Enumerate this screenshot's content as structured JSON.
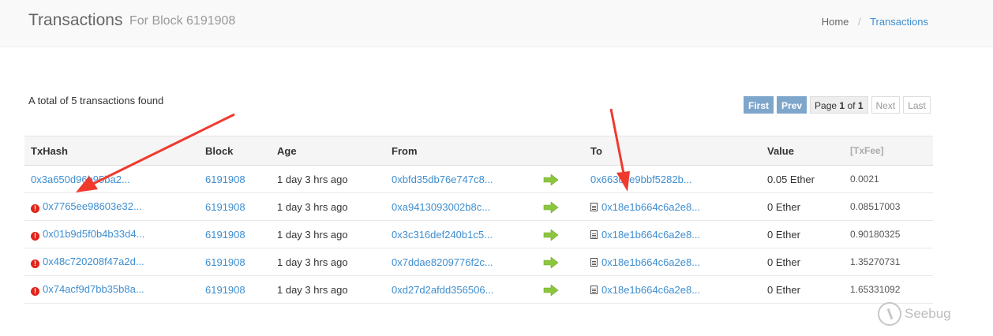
{
  "header": {
    "title": "Transactions",
    "subtitle": "For Block 6191908",
    "breadcrumb": {
      "home": "Home",
      "separator": "/",
      "current": "Transactions"
    }
  },
  "summary": {
    "total_text": "A total of 5 transactions found"
  },
  "pager": {
    "first": "First",
    "prev": "Prev",
    "page_prefix": "Page",
    "page_current": "1",
    "page_of": "of",
    "page_total": "1",
    "next": "Next",
    "last": "Last"
  },
  "table": {
    "columns": {
      "txhash": "TxHash",
      "block": "Block",
      "age": "Age",
      "from": "From",
      "to": "To",
      "value": "Value",
      "txfee": "[TxFee]"
    },
    "rows": [
      {
        "txhash": "0x3a650d96b95ba2...",
        "error": false,
        "block": "6191908",
        "age": "1 day 3 hrs ago",
        "from": "0xbfd35db76e747c8...",
        "to": "0x663c6e9bbf5282b...",
        "contract": false,
        "value": "0.05 Ether",
        "txfee": "0.0021"
      },
      {
        "txhash": "0x7765ee98603e32...",
        "error": true,
        "block": "6191908",
        "age": "1 day 3 hrs ago",
        "from": "0xa9413093002b8c...",
        "to": "0x18e1b664c6a2e8...",
        "contract": true,
        "value": "0 Ether",
        "txfee": "0.08517003"
      },
      {
        "txhash": "0x01b9d5f0b4b33d4...",
        "error": true,
        "block": "6191908",
        "age": "1 day 3 hrs ago",
        "from": "0x3c316def240b1c5...",
        "to": "0x18e1b664c6a2e8...",
        "contract": true,
        "value": "0 Ether",
        "txfee": "0.90180325"
      },
      {
        "txhash": "0x48c720208f47a2d...",
        "error": true,
        "block": "6191908",
        "age": "1 day 3 hrs ago",
        "from": "0x7ddae8209776f2c...",
        "to": "0x18e1b664c6a2e8...",
        "contract": true,
        "value": "0 Ether",
        "txfee": "1.35270731"
      },
      {
        "txhash": "0x74acf9d7bb35b8a...",
        "error": true,
        "block": "6191908",
        "age": "1 day 3 hrs ago",
        "from": "0xd27d2afdd356506...",
        "to": "0x18e1b664c6a2e8...",
        "contract": true,
        "value": "0 Ether",
        "txfee": "1.65331092"
      }
    ]
  },
  "icons": {
    "error": "exclamation-circle-icon",
    "direction": "green-right-arrow-icon",
    "contract": "file-text-icon"
  },
  "colors": {
    "link": "#3e8ed0",
    "error": "#e2231a",
    "arrow_green": "#8cc63f",
    "annotation_red": "#f03a2e",
    "pager_active": "#7ea6cb"
  },
  "watermark": {
    "text": "Seebug"
  }
}
